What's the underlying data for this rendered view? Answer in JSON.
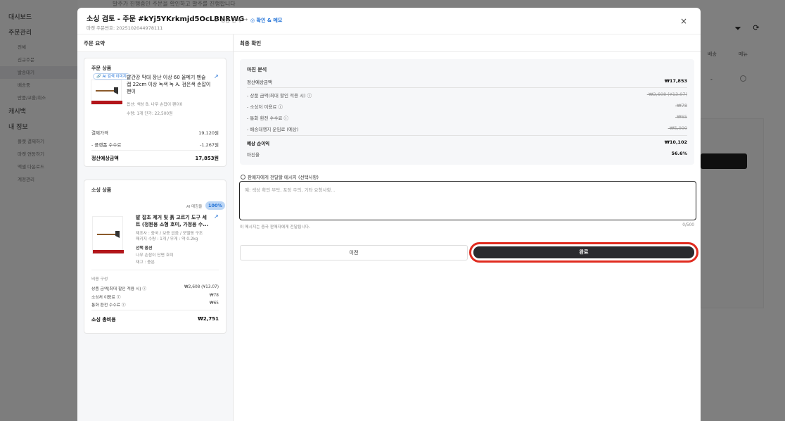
{
  "background": {
    "top_note": "발주가 진행중인 주문을 확인하고 발주를 진행합니다",
    "sidebar": {
      "items": [
        {
          "label": "대시보드",
          "kind": "main"
        },
        {
          "label": "주문관리",
          "kind": "main"
        },
        {
          "label": "전체",
          "kind": "sub"
        },
        {
          "label": "신규주문",
          "kind": "sub"
        },
        {
          "label": "발송대기",
          "kind": "sub",
          "active": true
        },
        {
          "label": "배송중",
          "kind": "sub"
        },
        {
          "label": "반품/교환/취소",
          "kind": "sub"
        },
        {
          "label": "캐시백",
          "kind": "main"
        },
        {
          "label": "내 정보",
          "kind": "main"
        },
        {
          "label": "플랫 결제하기",
          "kind": "sub"
        },
        {
          "label": "마켓 연동하기",
          "kind": "sub"
        },
        {
          "label": "엑셀 다운로드",
          "kind": "sub"
        },
        {
          "label": "계정관리",
          "kind": "sub"
        }
      ]
    },
    "table_cols": [
      "배송",
      "메뉴"
    ],
    "row_dash": "-"
  },
  "modal": {
    "title": "소싱 검토 - 주문 #kYj5YKrkmjd5OcLBNRWG",
    "subtitle": "마켓 주문번호: 2025102044978111",
    "steps": [
      "상품 선택",
      "→",
      "확인 & 메모"
    ],
    "step1_icon": "check-circle-icon",
    "close": "×",
    "left_header": "주문 요약",
    "right_header": "최종 확인",
    "order_product": {
      "title": "주문 상품",
      "ai_badge": "AI 검색 이미지",
      "name": "밭간강 막대 장난 이상 60 올메기 펜슬 캡 22cm 이상 녹색 녹 A. 검은색 손잡이 팬이",
      "option": "옵션: 색상 B. 나무 손잡이 팬이0",
      "qty": "수량: 1개   단가: 22,500원",
      "rows": [
        {
          "label": "결제가격",
          "value": "19,120원"
        },
        {
          "label": "- 플랫폼 수수료",
          "value": "-1,267원"
        }
      ],
      "settle_label": "정산예상금액",
      "settle_value": "17,853원"
    },
    "sourcing_product": {
      "title": "소싱 상품",
      "match_label": "AI 매칭율",
      "match_value": "100%",
      "name": "밭 잡초 제거 및 흙 고르기 도구 세트 (정원용 소형 호미, 가정용 수...",
      "desc1": "제조사 : 중국 / 보증 없음 / 모델명 구조",
      "desc2": "패키지 수량 : 1개 / 무게 : 약 0.2kg",
      "shipping": "선택 옵션",
      "option": "나무 손잡이 단면 호미",
      "stock": "재고 : 충분",
      "cost_title": "비용 구성",
      "costs": [
        {
          "label": "상품 금액(최대 할인 적용 시)",
          "value": "₩2,608 (¥13.07)",
          "info": true
        },
        {
          "label": "소싱처 이용료",
          "value": "₩78",
          "info": true
        },
        {
          "label": "통화 환전 수수료",
          "value": "₩65",
          "info": true
        }
      ],
      "total_label": "소싱 총비용",
      "total_value": "₩2,751"
    },
    "margin": {
      "title": "마진 분석",
      "settle_label": "정산예상금액",
      "settle_value": "₩17,853",
      "lines": [
        {
          "label": "- 상품 금액(최대 할인 적용 시)",
          "value": "-₩2,608 (¥13.07)",
          "info": true
        },
        {
          "label": "- 소싱처 이용료",
          "value": "-₩78",
          "info": true
        },
        {
          "label": "- 통화 환전 수수료",
          "value": "-₩65",
          "info": true
        },
        {
          "label": "- 배송대행지 운임료 (예상)",
          "value": "-₩5,000",
          "info": false
        }
      ],
      "profit_label": "예상 순이익",
      "profit_value": "₩10,102",
      "rate_label": "마진율",
      "rate_value": "56.6%"
    },
    "message": {
      "label": "판매자에게 전달할 메시지 (선택사항)",
      "placeholder": "예: 색상 확인 부탁, 포장 주의, 기타 요청사항...",
      "hint": "이 메시지는 중국 판매자에게 전달됩니다.",
      "counter": "0/500"
    },
    "buttons": {
      "prev": "이전",
      "done": "완료"
    }
  }
}
